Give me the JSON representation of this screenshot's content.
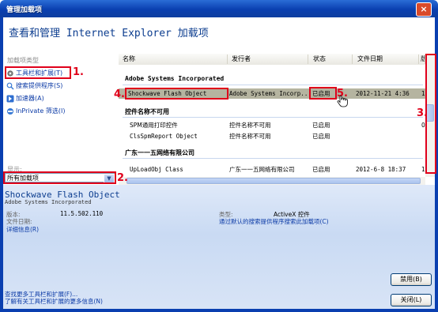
{
  "window": {
    "title": "管理加载项",
    "close_label": "×"
  },
  "header": {
    "title": "查看和管理 Internet Explorer 加载项"
  },
  "left": {
    "section_label": "加载项类型",
    "items": [
      {
        "label": "工具栏和扩展(T)",
        "icon": "gear-icon"
      },
      {
        "label": "搜索提供程序(S)",
        "icon": "search-icon"
      },
      {
        "label": "加速器(A)",
        "icon": "accelerator-icon"
      },
      {
        "label": "InPrivate 筛选(I)",
        "icon": "inprivate-icon"
      }
    ],
    "show_label": "显示:",
    "filter_value": "所有加载项"
  },
  "columns": [
    "名称",
    "发行者",
    "状态",
    "文件日期",
    "版"
  ],
  "groups": [
    {
      "name": "Adobe Systems Incorporated"
    },
    {
      "name": "控件名称不可用"
    },
    {
      "name": "广东一一五网络有限公司"
    }
  ],
  "rows": [
    {
      "name": "Shockwave Flash Object",
      "publisher": "Adobe Systems Incorp...",
      "status": "已启用",
      "date": "2012-11-21 4:36",
      "version": "11"
    },
    {
      "name": "SPM通用打印控件",
      "publisher": "控件名称不可用",
      "status": "已启用",
      "date": "",
      "version": "0"
    },
    {
      "name": "ClsSpmReport Object",
      "publisher": "控件名称不可用",
      "status": "已启用",
      "date": "",
      "version": ""
    },
    {
      "name": "UpLoadObj Class",
      "publisher": "广东一一五网络有限公司",
      "status": "已启用",
      "date": "2012-6-8 18:37",
      "version": "1"
    }
  ],
  "detail": {
    "name": "Shockwave Flash Object",
    "publisher": "Adobe Systems Incorporated",
    "version_label": "版本:",
    "version_value": "11.5.502.110",
    "file_date_label": "文件日期:",
    "more_info_link": "详细信息(R)",
    "type_label": "类型:",
    "type_value": "ActiveX 控件",
    "search_link": "通过默认的搜索提供程序搜索此加载项(C)",
    "disable_button": "禁用(B)",
    "close_button": "关闭(L)",
    "find_more_link": "查找更多工具栏和扩展(F)...",
    "learn_more_link": "了解有关工具栏和扩展的更多信息(N)"
  },
  "annotations": [
    "1.",
    "2.",
    "3.",
    "4.",
    "5."
  ],
  "colors": {
    "accent": "#0c3d8f",
    "annotation": "#e0001b",
    "title_bar": "#0a3fb0"
  }
}
